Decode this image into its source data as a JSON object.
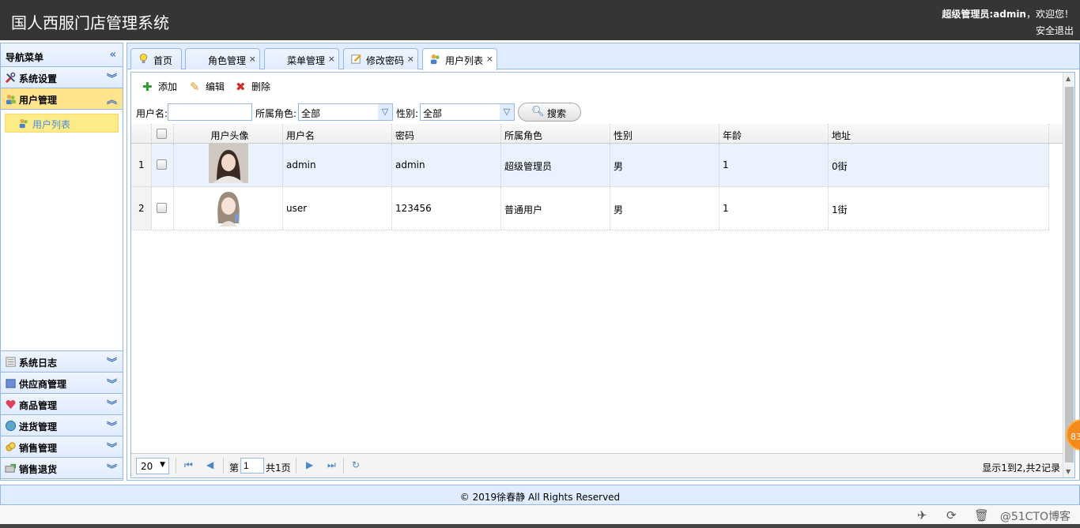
{
  "header": {
    "app_title": "国人西服门店管理系统",
    "user_role": "超级管理员:admin",
    "welcome": "，欢迎您！",
    "logout": "安全退出"
  },
  "nav": {
    "title": "导航菜单",
    "sections": [
      {
        "label": "系统设置",
        "icon": "tools-icon"
      },
      {
        "label": "用户管理",
        "icon": "users-icon",
        "selected": true,
        "items": [
          {
            "label": "用户列表",
            "icon": "user-list-icon"
          }
        ]
      },
      {
        "label": "系统日志",
        "icon": "log-icon"
      },
      {
        "label": "供应商管理",
        "icon": "cube-icon"
      },
      {
        "label": "商品管理",
        "icon": "heart-icon"
      },
      {
        "label": "进货管理",
        "icon": "globe-icon"
      },
      {
        "label": "销售管理",
        "icon": "coins-icon"
      },
      {
        "label": "销售退货",
        "icon": "return-icon"
      }
    ]
  },
  "tabs": [
    {
      "label": "首页",
      "icon": "lightbulb-icon",
      "closable": false
    },
    {
      "label": "角色管理",
      "closable": true
    },
    {
      "label": "菜单管理",
      "closable": true
    },
    {
      "label": "修改密码",
      "icon": "edit-icon",
      "closable": true
    },
    {
      "label": "用户列表",
      "icon": "users-icon",
      "closable": true,
      "selected": true
    }
  ],
  "toolbar": {
    "add": "添加",
    "edit": "编辑",
    "delete": "删除"
  },
  "filters": {
    "username_label": "用户名:",
    "username_value": "",
    "role_label": "所属角色:",
    "role_value": "全部",
    "gender_label": "性别:",
    "gender_value": "全部",
    "search": "搜索"
  },
  "table": {
    "columns": [
      "用户头像",
      "用户名",
      "密码",
      "所属角色",
      "性别",
      "年龄",
      "地址"
    ],
    "rows": [
      {
        "num": "1",
        "username": "admin",
        "password": "admin",
        "role": "超级管理员",
        "gender": "男",
        "age": "1",
        "address": "0街"
      },
      {
        "num": "2",
        "username": "user",
        "password": "123456",
        "role": "普通用户",
        "gender": "男",
        "age": "1",
        "address": "1街"
      }
    ]
  },
  "pager": {
    "page_size": "20",
    "page_prefix": "第",
    "page": "1",
    "page_total": "共1页",
    "summary": "显示1到2,共2记录"
  },
  "footer": {
    "copyright": "© 2019徐春静 All Rights Reserved",
    "watermark": "@51CTO博客"
  },
  "badge": "83",
  "colors": {
    "header_bg": "#353535",
    "border": "#95b8e7",
    "panel_bg": "#e0ecff",
    "selected_bg": "#ffe48d"
  }
}
